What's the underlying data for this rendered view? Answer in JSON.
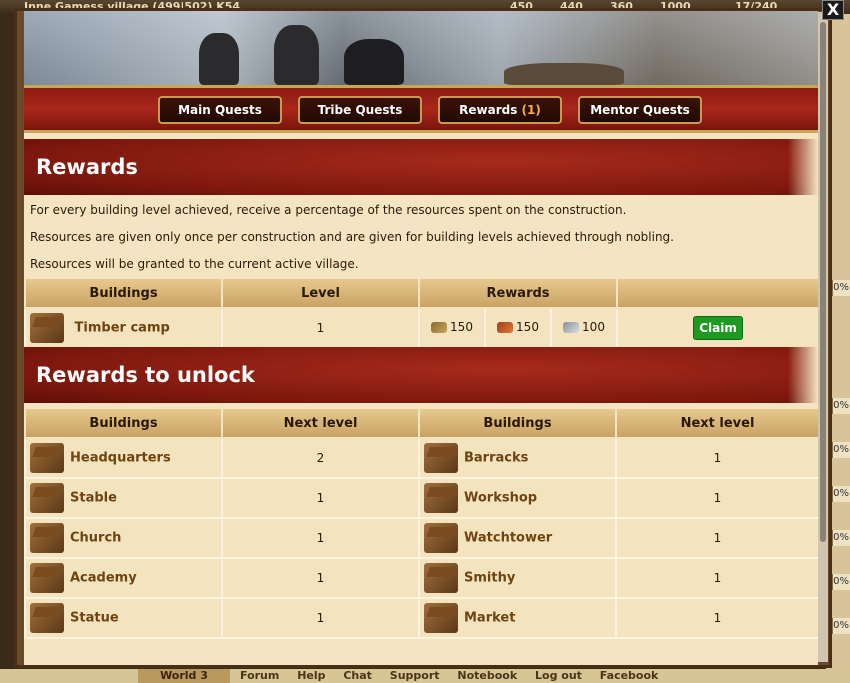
{
  "top_bar": {
    "village": "Inne Gamess village (499|502) K54",
    "res_wood": "450",
    "res_clay": "440",
    "res_iron": "360",
    "storage": "1000",
    "population": "17/240"
  },
  "tabs": [
    {
      "label": "Main Quests"
    },
    {
      "label": "Tribe Quests"
    },
    {
      "label": "Rewards",
      "count": "(1)"
    },
    {
      "label": "Mentor Quests"
    }
  ],
  "rewards": {
    "title": "Rewards",
    "info": [
      "For every building level achieved, receive a percentage of the resources spent on the construction.",
      "Resources are given only once per construction and are given for building levels achieved through nobling.",
      "Resources will be granted to the current active village."
    ],
    "columns": [
      "Buildings",
      "Level",
      "Rewards",
      ""
    ],
    "row": {
      "building": "Timber camp",
      "level": "1",
      "wood": "150",
      "clay": "150",
      "iron": "100",
      "claim": "Claim"
    }
  },
  "unlock": {
    "title": "Rewards to unlock",
    "columns": [
      "Buildings",
      "Next level",
      "Buildings",
      "Next level"
    ],
    "rows": [
      {
        "b1": "Headquarters",
        "l1": "2",
        "b2": "Barracks",
        "l2": "1"
      },
      {
        "b1": "Stable",
        "l1": "1",
        "b2": "Workshop",
        "l2": "1"
      },
      {
        "b1": "Church",
        "l1": "1",
        "b2": "Watchtower",
        "l2": "1"
      },
      {
        "b1": "Academy",
        "l1": "1",
        "b2": "Smithy",
        "l2": "1"
      },
      {
        "b1": "Statue",
        "l1": "1",
        "b2": "Market",
        "l2": "1"
      }
    ]
  },
  "bottom_bar": {
    "world": "World 3",
    "links": [
      "Forum",
      "Help",
      "Chat",
      "Support",
      "Notebook",
      "Log out",
      "Facebook"
    ]
  },
  "side_percent": "0%",
  "close": "X",
  "colors": {
    "accent_red": "#8e1a10",
    "gold_border": "#c9a55a",
    "claim_green": "#1e9a22",
    "building_link": "#6e4411"
  }
}
